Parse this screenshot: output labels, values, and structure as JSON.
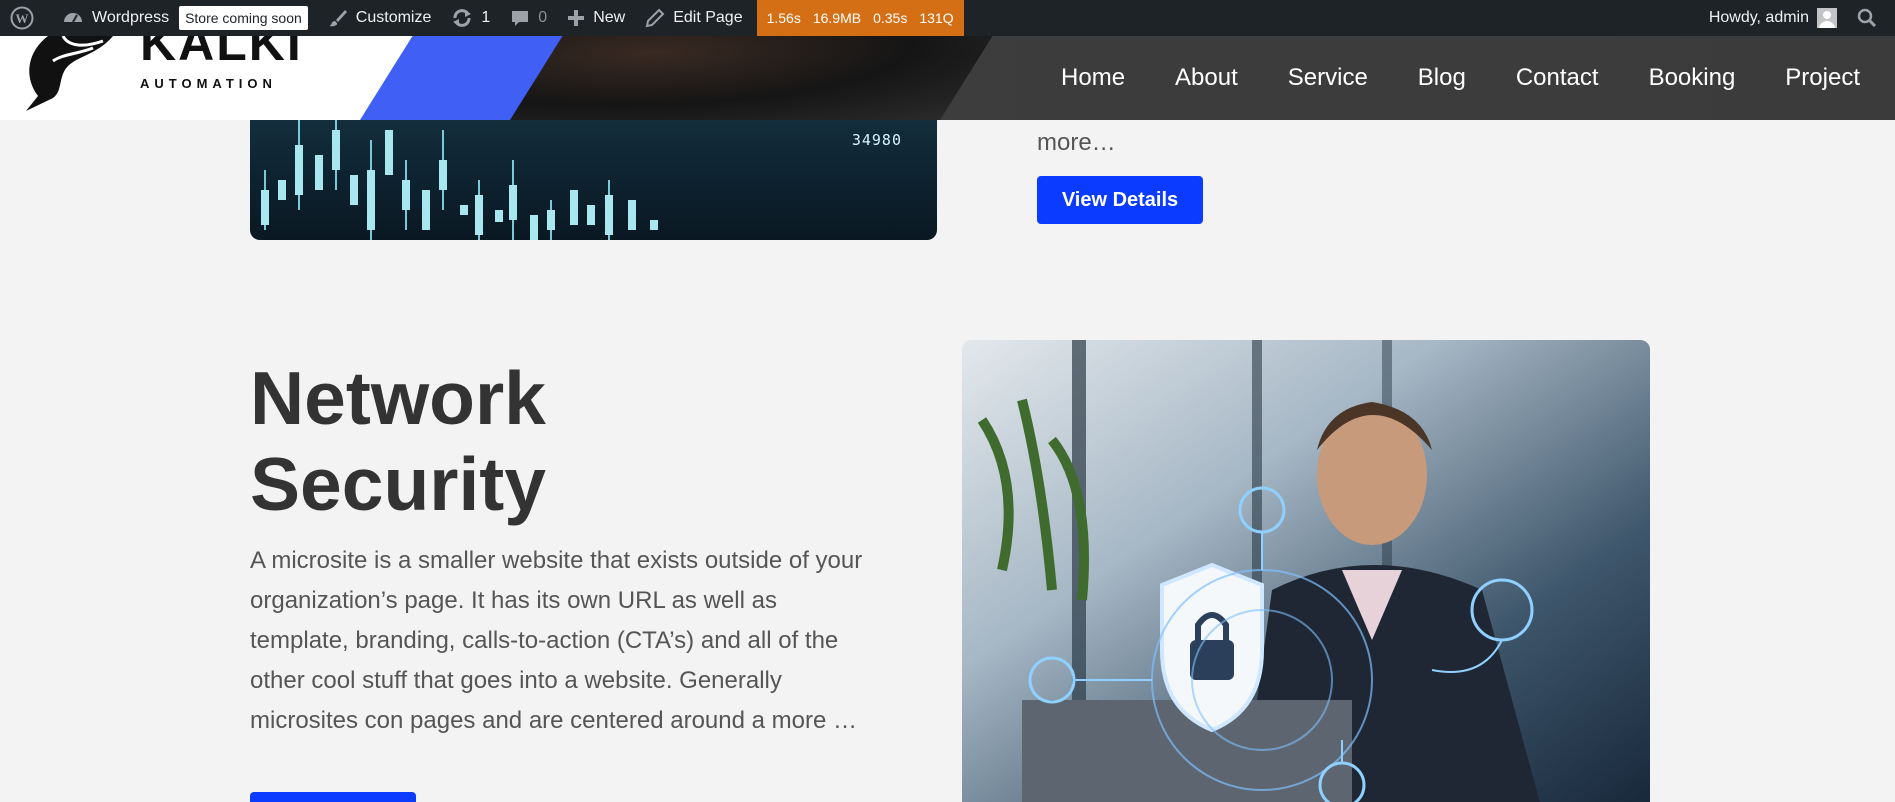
{
  "adminbar": {
    "site_name": "Wordpress",
    "store_badge": "Store coming soon",
    "customize": "Customize",
    "updates_count": "1",
    "comments_count": "0",
    "new_label": "New",
    "edit_page": "Edit Page",
    "qm": {
      "time": "1.56s",
      "memory": "16.9MB",
      "db_time": "0.35s",
      "queries": "131Q"
    },
    "howdy": "Howdy, admin"
  },
  "header": {
    "logo_name": "KALKI",
    "logo_sub": "AUTOMATION",
    "nav": [
      "Home",
      "About",
      "Service",
      "Blog",
      "Contact",
      "Booking",
      "Project"
    ]
  },
  "top_section": {
    "image_number": "34980",
    "more_text": "more…",
    "button_label": "View Details"
  },
  "network_security": {
    "title": "Network Security",
    "body": "A microsite is a smaller website that exists outside of your organization’s page. It has its own URL as well as template, branding, calls-to-action (CTA’s) and all of the other cool stuff that goes into a website. Generally microsites con pages and are centered around a more …"
  },
  "colors": {
    "adminbar_bg": "#1d2327",
    "qm_bg": "#d46f15",
    "accent_blue": "#0b3bff",
    "logo_stripe": "#3f5ff5",
    "page_bg": "#f3f3f3"
  }
}
